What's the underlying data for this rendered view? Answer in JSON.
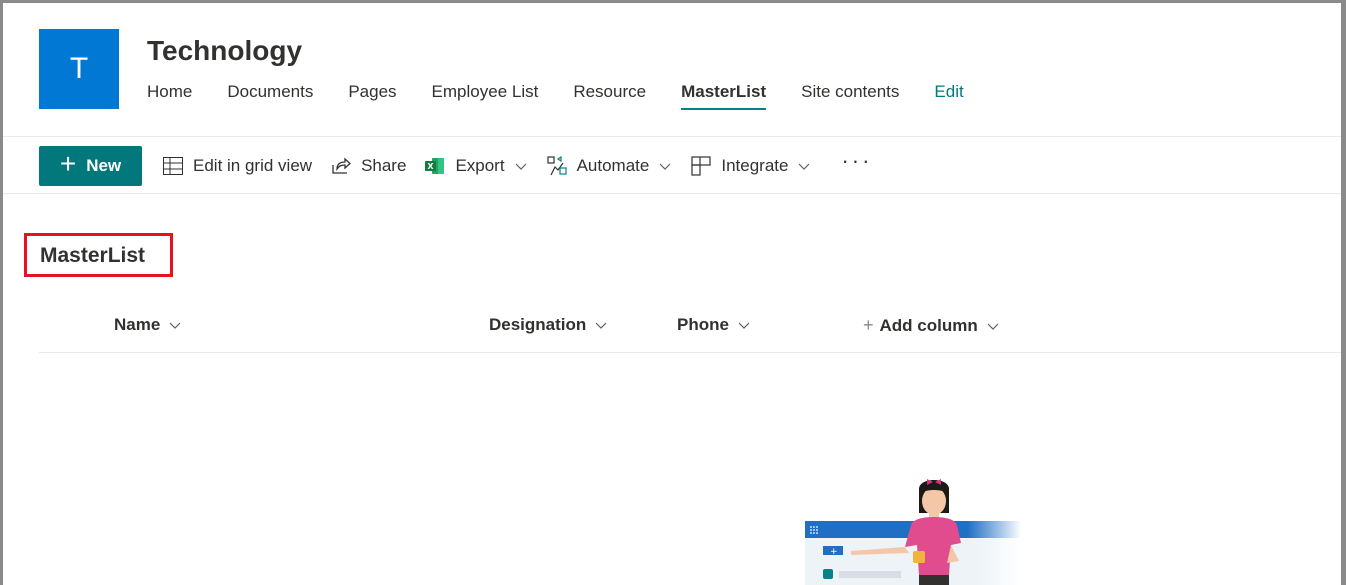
{
  "site": {
    "logo_letter": "T",
    "title": "Technology",
    "nav": [
      {
        "label": "Home"
      },
      {
        "label": "Documents"
      },
      {
        "label": "Pages"
      },
      {
        "label": "Employee List"
      },
      {
        "label": "Resource"
      },
      {
        "label": "MasterList",
        "active": true
      },
      {
        "label": "Site contents"
      },
      {
        "label": "Edit"
      }
    ]
  },
  "commands": {
    "new_label": "New",
    "edit_grid": "Edit in grid view",
    "share": "Share",
    "export": "Export",
    "automate": "Automate",
    "integrate": "Integrate",
    "more": "···"
  },
  "list": {
    "title": "MasterList",
    "columns": [
      "Name",
      "Designation",
      "Phone"
    ],
    "add_column": "Add column"
  },
  "colors": {
    "accent": "#03787c",
    "logo": "#0078d4",
    "highlight_box": "#e81123"
  }
}
